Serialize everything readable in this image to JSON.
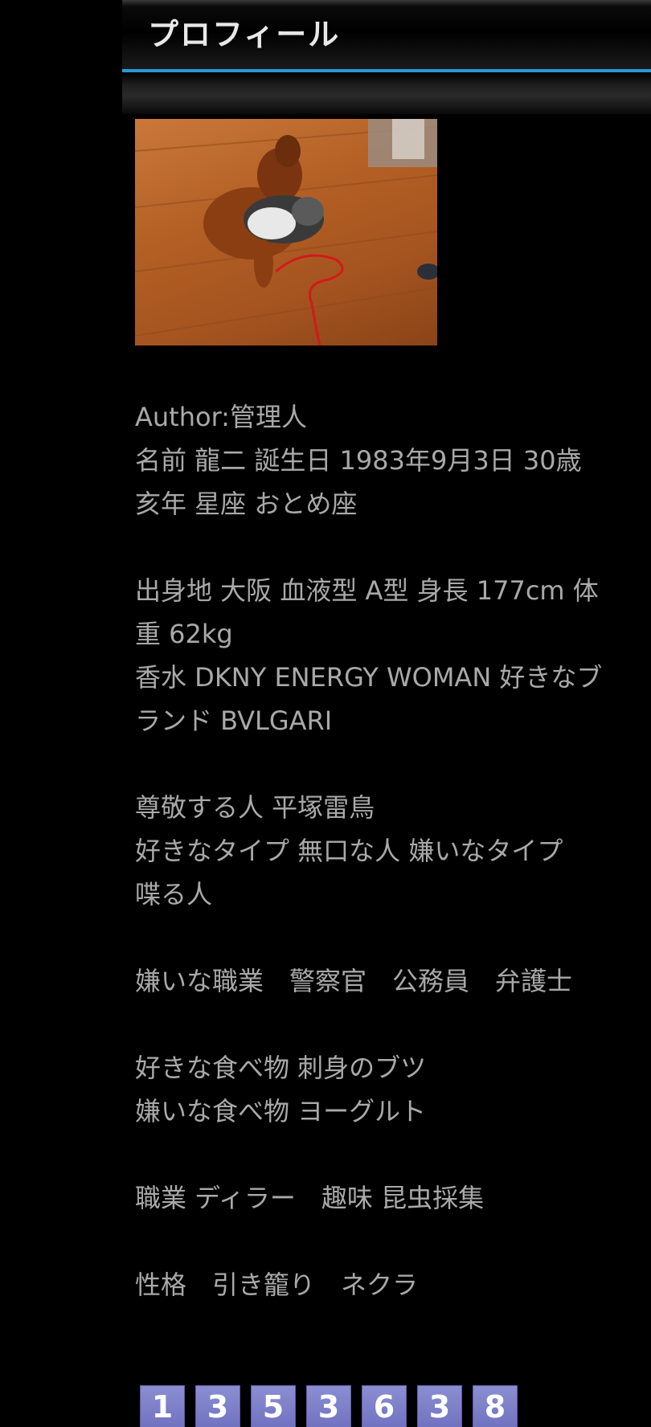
{
  "header": {
    "title": "プロフィール",
    "accent_color": "#2a9bd6"
  },
  "photo": {
    "icon": "profile-photo-dog-and-cat"
  },
  "profile": {
    "lines": [
      "Author:管理人",
      "名前 龍二 誕生日 1983年9月3日 30歳",
      "亥年 星座 おとめ座",
      "",
      "出身地 大阪 血液型 A型 身長 177cm 体",
      "重 62kg",
      "香水 DKNY ENERGY WOMAN 好きなブ",
      "ランド BVLGARI",
      "",
      "尊敬する人 平塚雷鳥",
      "好きなタイプ 無口な人 嫌いなタイプ",
      "喋る人",
      "",
      "嫌いな職業　警察官　公務員　弁護士",
      "",
      "好きな食べ物 刺身のブツ",
      "嫌いな食べ物 ヨーグルト",
      "",
      "職業 ディラー　趣味 昆虫採集",
      "",
      "性格　引き籠り　ネクラ"
    ]
  },
  "counter": {
    "digits": [
      "1",
      "3",
      "5",
      "3",
      "6",
      "3",
      "8"
    ],
    "color": "#7c7ec8"
  }
}
